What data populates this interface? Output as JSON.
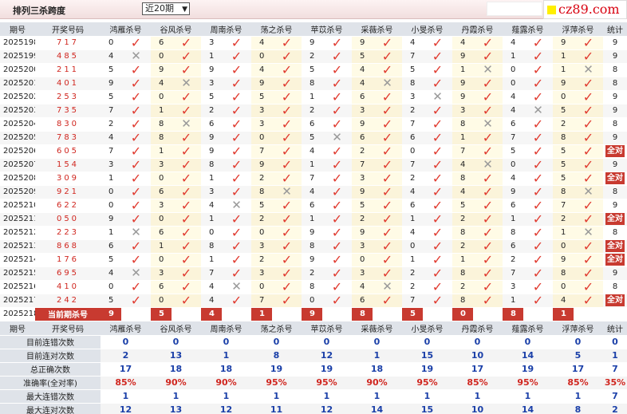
{
  "header": {
    "title": "排列三杀跨度",
    "period_select": "近20期",
    "logo_text": "cz89.com"
  },
  "columns": [
    "期号",
    "开奖号码",
    "鸿雁杀号",
    "谷风杀号",
    "周南杀号",
    "荡之杀号",
    "苹苡杀号",
    "采薇杀号",
    "小旻杀号",
    "丹霞杀号",
    "薤露杀号",
    "浮萍杀号",
    "统计"
  ],
  "rows": [
    {
      "period": "2025198",
      "prize": "717",
      "picks": [
        [
          0,
          "ok"
        ],
        [
          6,
          "ok"
        ],
        [
          3,
          "ok"
        ],
        [
          4,
          "ok"
        ],
        [
          9,
          "ok"
        ],
        [
          9,
          "ok"
        ],
        [
          4,
          "ok"
        ],
        [
          4,
          "ok"
        ],
        [
          4,
          "ok"
        ],
        [
          9,
          "ok"
        ]
      ],
      "stat": "9"
    },
    {
      "period": "2025199",
      "prize": "485",
      "picks": [
        [
          4,
          "x"
        ],
        [
          0,
          "ok"
        ],
        [
          1,
          "ok"
        ],
        [
          0,
          "ok"
        ],
        [
          2,
          "ok"
        ],
        [
          5,
          "ok"
        ],
        [
          7,
          "ok"
        ],
        [
          9,
          "ok"
        ],
        [
          1,
          "ok"
        ],
        [
          1,
          "ok"
        ]
      ],
      "stat": "9"
    },
    {
      "period": "2025200",
      "prize": "211",
      "picks": [
        [
          5,
          "ok"
        ],
        [
          9,
          "ok"
        ],
        [
          9,
          "ok"
        ],
        [
          4,
          "ok"
        ],
        [
          5,
          "ok"
        ],
        [
          4,
          "ok"
        ],
        [
          5,
          "ok"
        ],
        [
          1,
          "x"
        ],
        [
          0,
          "ok"
        ],
        [
          1,
          "x"
        ]
      ],
      "stat": "8"
    },
    {
      "period": "2025201",
      "prize": "401",
      "picks": [
        [
          9,
          "ok"
        ],
        [
          4,
          "x"
        ],
        [
          3,
          "ok"
        ],
        [
          9,
          "ok"
        ],
        [
          8,
          "ok"
        ],
        [
          4,
          "x"
        ],
        [
          8,
          "ok"
        ],
        [
          9,
          "ok"
        ],
        [
          0,
          "ok"
        ],
        [
          9,
          "ok"
        ]
      ],
      "stat": "8"
    },
    {
      "period": "2025202",
      "prize": "253",
      "picks": [
        [
          5,
          "ok"
        ],
        [
          0,
          "ok"
        ],
        [
          5,
          "ok"
        ],
        [
          5,
          "ok"
        ],
        [
          1,
          "ok"
        ],
        [
          6,
          "ok"
        ],
        [
          3,
          "x"
        ],
        [
          9,
          "ok"
        ],
        [
          4,
          "ok"
        ],
        [
          0,
          "ok"
        ]
      ],
      "stat": "9"
    },
    {
      "period": "2025203",
      "prize": "735",
      "picks": [
        [
          7,
          "ok"
        ],
        [
          1,
          "ok"
        ],
        [
          2,
          "ok"
        ],
        [
          3,
          "ok"
        ],
        [
          2,
          "ok"
        ],
        [
          3,
          "ok"
        ],
        [
          2,
          "ok"
        ],
        [
          3,
          "ok"
        ],
        [
          4,
          "x"
        ],
        [
          5,
          "ok"
        ]
      ],
      "stat": "9"
    },
    {
      "period": "2025204",
      "prize": "830",
      "picks": [
        [
          2,
          "ok"
        ],
        [
          8,
          "x"
        ],
        [
          6,
          "ok"
        ],
        [
          3,
          "ok"
        ],
        [
          6,
          "ok"
        ],
        [
          9,
          "ok"
        ],
        [
          7,
          "ok"
        ],
        [
          8,
          "x"
        ],
        [
          6,
          "ok"
        ],
        [
          2,
          "ok"
        ]
      ],
      "stat": "8"
    },
    {
      "period": "2025205",
      "prize": "783",
      "picks": [
        [
          4,
          "ok"
        ],
        [
          8,
          "ok"
        ],
        [
          9,
          "ok"
        ],
        [
          0,
          "ok"
        ],
        [
          5,
          "x"
        ],
        [
          6,
          "ok"
        ],
        [
          6,
          "ok"
        ],
        [
          1,
          "ok"
        ],
        [
          7,
          "ok"
        ],
        [
          8,
          "ok"
        ]
      ],
      "stat": "9"
    },
    {
      "period": "2025206",
      "prize": "605",
      "picks": [
        [
          7,
          "ok"
        ],
        [
          1,
          "ok"
        ],
        [
          9,
          "ok"
        ],
        [
          7,
          "ok"
        ],
        [
          4,
          "ok"
        ],
        [
          2,
          "ok"
        ],
        [
          0,
          "ok"
        ],
        [
          7,
          "ok"
        ],
        [
          5,
          "ok"
        ],
        [
          5,
          "ok"
        ]
      ],
      "stat": "全对"
    },
    {
      "period": "2025207",
      "prize": "154",
      "picks": [
        [
          3,
          "ok"
        ],
        [
          3,
          "ok"
        ],
        [
          8,
          "ok"
        ],
        [
          9,
          "ok"
        ],
        [
          1,
          "ok"
        ],
        [
          7,
          "ok"
        ],
        [
          7,
          "ok"
        ],
        [
          4,
          "x"
        ],
        [
          0,
          "ok"
        ],
        [
          5,
          "ok"
        ]
      ],
      "stat": "9"
    },
    {
      "period": "2025208",
      "prize": "309",
      "picks": [
        [
          1,
          "ok"
        ],
        [
          0,
          "ok"
        ],
        [
          1,
          "ok"
        ],
        [
          2,
          "ok"
        ],
        [
          7,
          "ok"
        ],
        [
          3,
          "ok"
        ],
        [
          2,
          "ok"
        ],
        [
          8,
          "ok"
        ],
        [
          4,
          "ok"
        ],
        [
          5,
          "ok"
        ]
      ],
      "stat": "全对"
    },
    {
      "period": "2025209",
      "prize": "921",
      "picks": [
        [
          0,
          "ok"
        ],
        [
          6,
          "ok"
        ],
        [
          3,
          "ok"
        ],
        [
          8,
          "x"
        ],
        [
          4,
          "ok"
        ],
        [
          9,
          "ok"
        ],
        [
          4,
          "ok"
        ],
        [
          4,
          "ok"
        ],
        [
          9,
          "ok"
        ],
        [
          8,
          "x"
        ]
      ],
      "stat": "8"
    },
    {
      "period": "2025210",
      "prize": "622",
      "picks": [
        [
          0,
          "ok"
        ],
        [
          3,
          "ok"
        ],
        [
          4,
          "x"
        ],
        [
          5,
          "ok"
        ],
        [
          6,
          "ok"
        ],
        [
          5,
          "ok"
        ],
        [
          6,
          "ok"
        ],
        [
          5,
          "ok"
        ],
        [
          6,
          "ok"
        ],
        [
          7,
          "ok"
        ]
      ],
      "stat": "9"
    },
    {
      "period": "2025211",
      "prize": "050",
      "picks": [
        [
          9,
          "ok"
        ],
        [
          0,
          "ok"
        ],
        [
          1,
          "ok"
        ],
        [
          2,
          "ok"
        ],
        [
          1,
          "ok"
        ],
        [
          2,
          "ok"
        ],
        [
          1,
          "ok"
        ],
        [
          2,
          "ok"
        ],
        [
          1,
          "ok"
        ],
        [
          2,
          "ok"
        ]
      ],
      "stat": "全对"
    },
    {
      "period": "2025212",
      "prize": "223",
      "picks": [
        [
          1,
          "x"
        ],
        [
          6,
          "ok"
        ],
        [
          0,
          "ok"
        ],
        [
          0,
          "ok"
        ],
        [
          9,
          "ok"
        ],
        [
          9,
          "ok"
        ],
        [
          4,
          "ok"
        ],
        [
          8,
          "ok"
        ],
        [
          8,
          "ok"
        ],
        [
          1,
          "x"
        ]
      ],
      "stat": "8"
    },
    {
      "period": "2025213",
      "prize": "868",
      "picks": [
        [
          6,
          "ok"
        ],
        [
          1,
          "ok"
        ],
        [
          8,
          "ok"
        ],
        [
          3,
          "ok"
        ],
        [
          8,
          "ok"
        ],
        [
          3,
          "ok"
        ],
        [
          0,
          "ok"
        ],
        [
          2,
          "ok"
        ],
        [
          6,
          "ok"
        ],
        [
          0,
          "ok"
        ]
      ],
      "stat": "全对"
    },
    {
      "period": "2025214",
      "prize": "176",
      "picks": [
        [
          5,
          "ok"
        ],
        [
          0,
          "ok"
        ],
        [
          1,
          "ok"
        ],
        [
          2,
          "ok"
        ],
        [
          9,
          "ok"
        ],
        [
          0,
          "ok"
        ],
        [
          1,
          "ok"
        ],
        [
          1,
          "ok"
        ],
        [
          2,
          "ok"
        ],
        [
          9,
          "ok"
        ]
      ],
      "stat": "全对"
    },
    {
      "period": "2025215",
      "prize": "695",
      "picks": [
        [
          4,
          "x"
        ],
        [
          3,
          "ok"
        ],
        [
          7,
          "ok"
        ],
        [
          3,
          "ok"
        ],
        [
          2,
          "ok"
        ],
        [
          3,
          "ok"
        ],
        [
          2,
          "ok"
        ],
        [
          8,
          "ok"
        ],
        [
          7,
          "ok"
        ],
        [
          8,
          "ok"
        ]
      ],
      "stat": "9"
    },
    {
      "period": "2025216",
      "prize": "410",
      "picks": [
        [
          0,
          "ok"
        ],
        [
          6,
          "ok"
        ],
        [
          4,
          "x"
        ],
        [
          0,
          "ok"
        ],
        [
          8,
          "ok"
        ],
        [
          4,
          "x"
        ],
        [
          2,
          "ok"
        ],
        [
          2,
          "ok"
        ],
        [
          3,
          "ok"
        ],
        [
          0,
          "ok"
        ]
      ],
      "stat": "8"
    },
    {
      "period": "2025217",
      "prize": "242",
      "picks": [
        [
          5,
          "ok"
        ],
        [
          0,
          "ok"
        ],
        [
          4,
          "ok"
        ],
        [
          7,
          "ok"
        ],
        [
          0,
          "ok"
        ],
        [
          6,
          "ok"
        ],
        [
          7,
          "ok"
        ],
        [
          8,
          "ok"
        ],
        [
          1,
          "ok"
        ],
        [
          4,
          "ok"
        ]
      ],
      "stat": "全对"
    }
  ],
  "current": {
    "period": "2025218",
    "label": "当前期杀号",
    "picks": [
      "9",
      "5",
      "4",
      "1",
      "9",
      "8",
      "5",
      "0",
      "8",
      "1"
    ]
  },
  "stats_header": [
    "期号",
    "开奖号码",
    "鸿雁杀号",
    "谷风杀号",
    "周南杀号",
    "荡之杀号",
    "苹苡杀号",
    "采薇杀号",
    "小旻杀号",
    "丹霞杀号",
    "薤露杀号",
    "浮萍杀号",
    "统计"
  ],
  "stats": [
    {
      "label": "目前连错次数",
      "values": [
        "0",
        "0",
        "0",
        "0",
        "0",
        "0",
        "0",
        "0",
        "0",
        "0",
        "0"
      ]
    },
    {
      "label": "目前连对次数",
      "values": [
        "2",
        "13",
        "1",
        "8",
        "12",
        "1",
        "15",
        "10",
        "14",
        "5",
        "1"
      ]
    },
    {
      "label": "总正确次数",
      "values": [
        "17",
        "18",
        "18",
        "19",
        "19",
        "18",
        "19",
        "17",
        "19",
        "17",
        "7"
      ]
    },
    {
      "label": "准确率(全对率)",
      "values": [
        "85%",
        "90%",
        "90%",
        "95%",
        "95%",
        "90%",
        "95%",
        "85%",
        "95%",
        "85%",
        "35%"
      ]
    },
    {
      "label": "最大连错次数",
      "values": [
        "1",
        "1",
        "1",
        "1",
        "1",
        "1",
        "1",
        "1",
        "1",
        "1",
        "7"
      ]
    },
    {
      "label": "最大连对次数",
      "values": [
        "12",
        "13",
        "12",
        "11",
        "12",
        "14",
        "15",
        "10",
        "14",
        "8",
        "2"
      ]
    }
  ],
  "colors": {
    "accent": "#c83a30",
    "prize": "#d0261f",
    "stat_value": "#1a3fa8",
    "header_bg": "#dfe3e9"
  },
  "icons": {
    "ok": "check-icon",
    "x": "cross-icon"
  }
}
